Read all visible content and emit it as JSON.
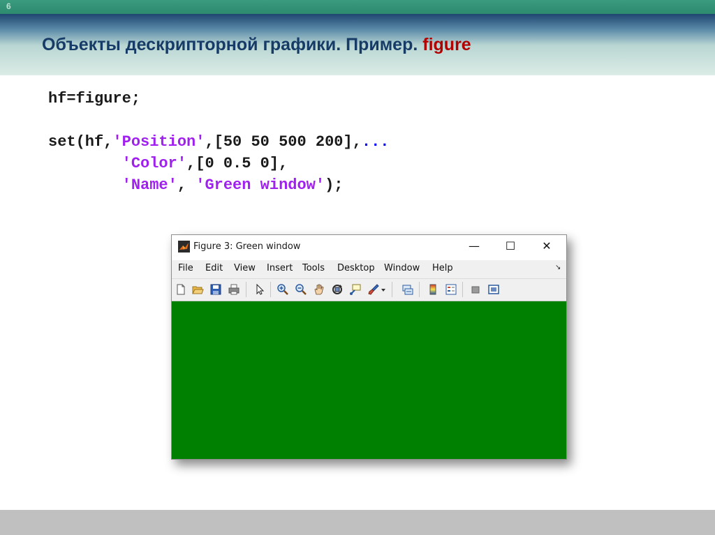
{
  "slide": {
    "number": "6",
    "title_main": "Объекты дескрипторной графики. Пример.",
    "title_accent": "figure"
  },
  "code": {
    "line1": "hf=figure;",
    "line2_prefix": "set(hf,",
    "line2_str": "'Position'",
    "line2_mid": ",[50 50 500 200],",
    "line2_cont": "...",
    "line3_indent": "        ",
    "line3_str": "'Color'",
    "line3_rest": ",[0 0.5 0],",
    "line4_indent": "        ",
    "line4_str1": "'Name'",
    "line4_mid": ", ",
    "line4_str2": "'Green window'",
    "line4_rest": ");"
  },
  "figure_window": {
    "title": "Figure 3: Green window",
    "minimize_glyph": "—",
    "maximize_glyph": "☐",
    "close_glyph": "✕",
    "background_color": "#008000",
    "menu": [
      "File",
      "Edit",
      "View",
      "Insert",
      "Tools",
      "Desktop",
      "Window",
      "Help"
    ],
    "menu_more_glyph": "↘",
    "toolbar_icons": [
      "new-figure-icon",
      "open-file-icon",
      "save-icon",
      "print-icon",
      "select-arrow-icon",
      "zoom-in-icon",
      "zoom-out-icon",
      "pan-hand-icon",
      "rotate-3d-icon",
      "data-cursor-icon",
      "brush-icon",
      "brush-dropdown-icon",
      "link-plot-icon",
      "insert-colorbar-icon",
      "insert-legend-icon",
      "hide-plot-tools-icon",
      "show-plot-tools-icon"
    ]
  }
}
